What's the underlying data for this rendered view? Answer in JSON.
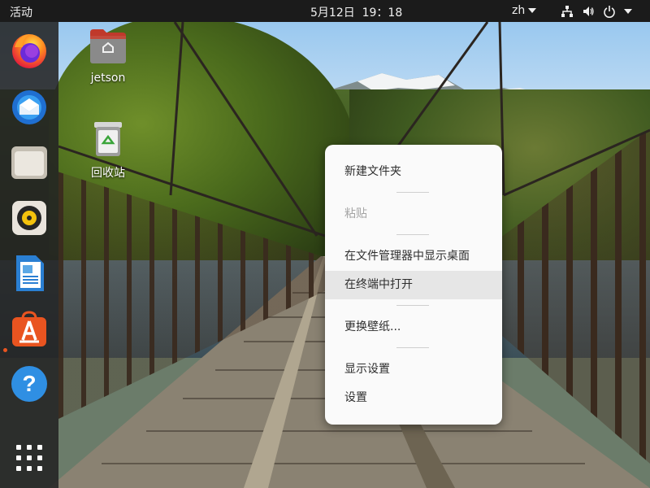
{
  "topbar": {
    "activities_label": "活动",
    "clock": "5月12日  19：18",
    "input_method": "zh"
  },
  "dock": {
    "items": [
      {
        "name": "firefox"
      },
      {
        "name": "thunderbird"
      },
      {
        "name": "files"
      },
      {
        "name": "rhythmbox"
      },
      {
        "name": "libreoffice-writer"
      },
      {
        "name": "ubuntu-software",
        "running": true
      },
      {
        "name": "help"
      },
      {
        "name": "show-applications"
      }
    ]
  },
  "desktop": {
    "icons": [
      {
        "label": "jetson",
        "icon": "home-folder-icon"
      },
      {
        "label": "回收站",
        "icon": "trash-icon"
      }
    ]
  },
  "context_menu": {
    "items": [
      {
        "label": "新建文件夹",
        "enabled": true
      },
      {
        "label": "粘贴",
        "enabled": false
      },
      {
        "label": "在文件管理器中显示桌面",
        "enabled": true
      },
      {
        "label": "在终端中打开",
        "enabled": true,
        "highlighted": true
      },
      {
        "label": "更换壁纸...",
        "enabled": true
      },
      {
        "label": "显示设置",
        "enabled": true
      },
      {
        "label": "设置",
        "enabled": true
      }
    ]
  },
  "colors": {
    "topbar_bg": "#1b1b1b",
    "dock_bg": "#232323",
    "ubuntu_orange": "#e95420",
    "menu_bg": "#fafafa",
    "menu_highlight": "#e6e6e6"
  }
}
